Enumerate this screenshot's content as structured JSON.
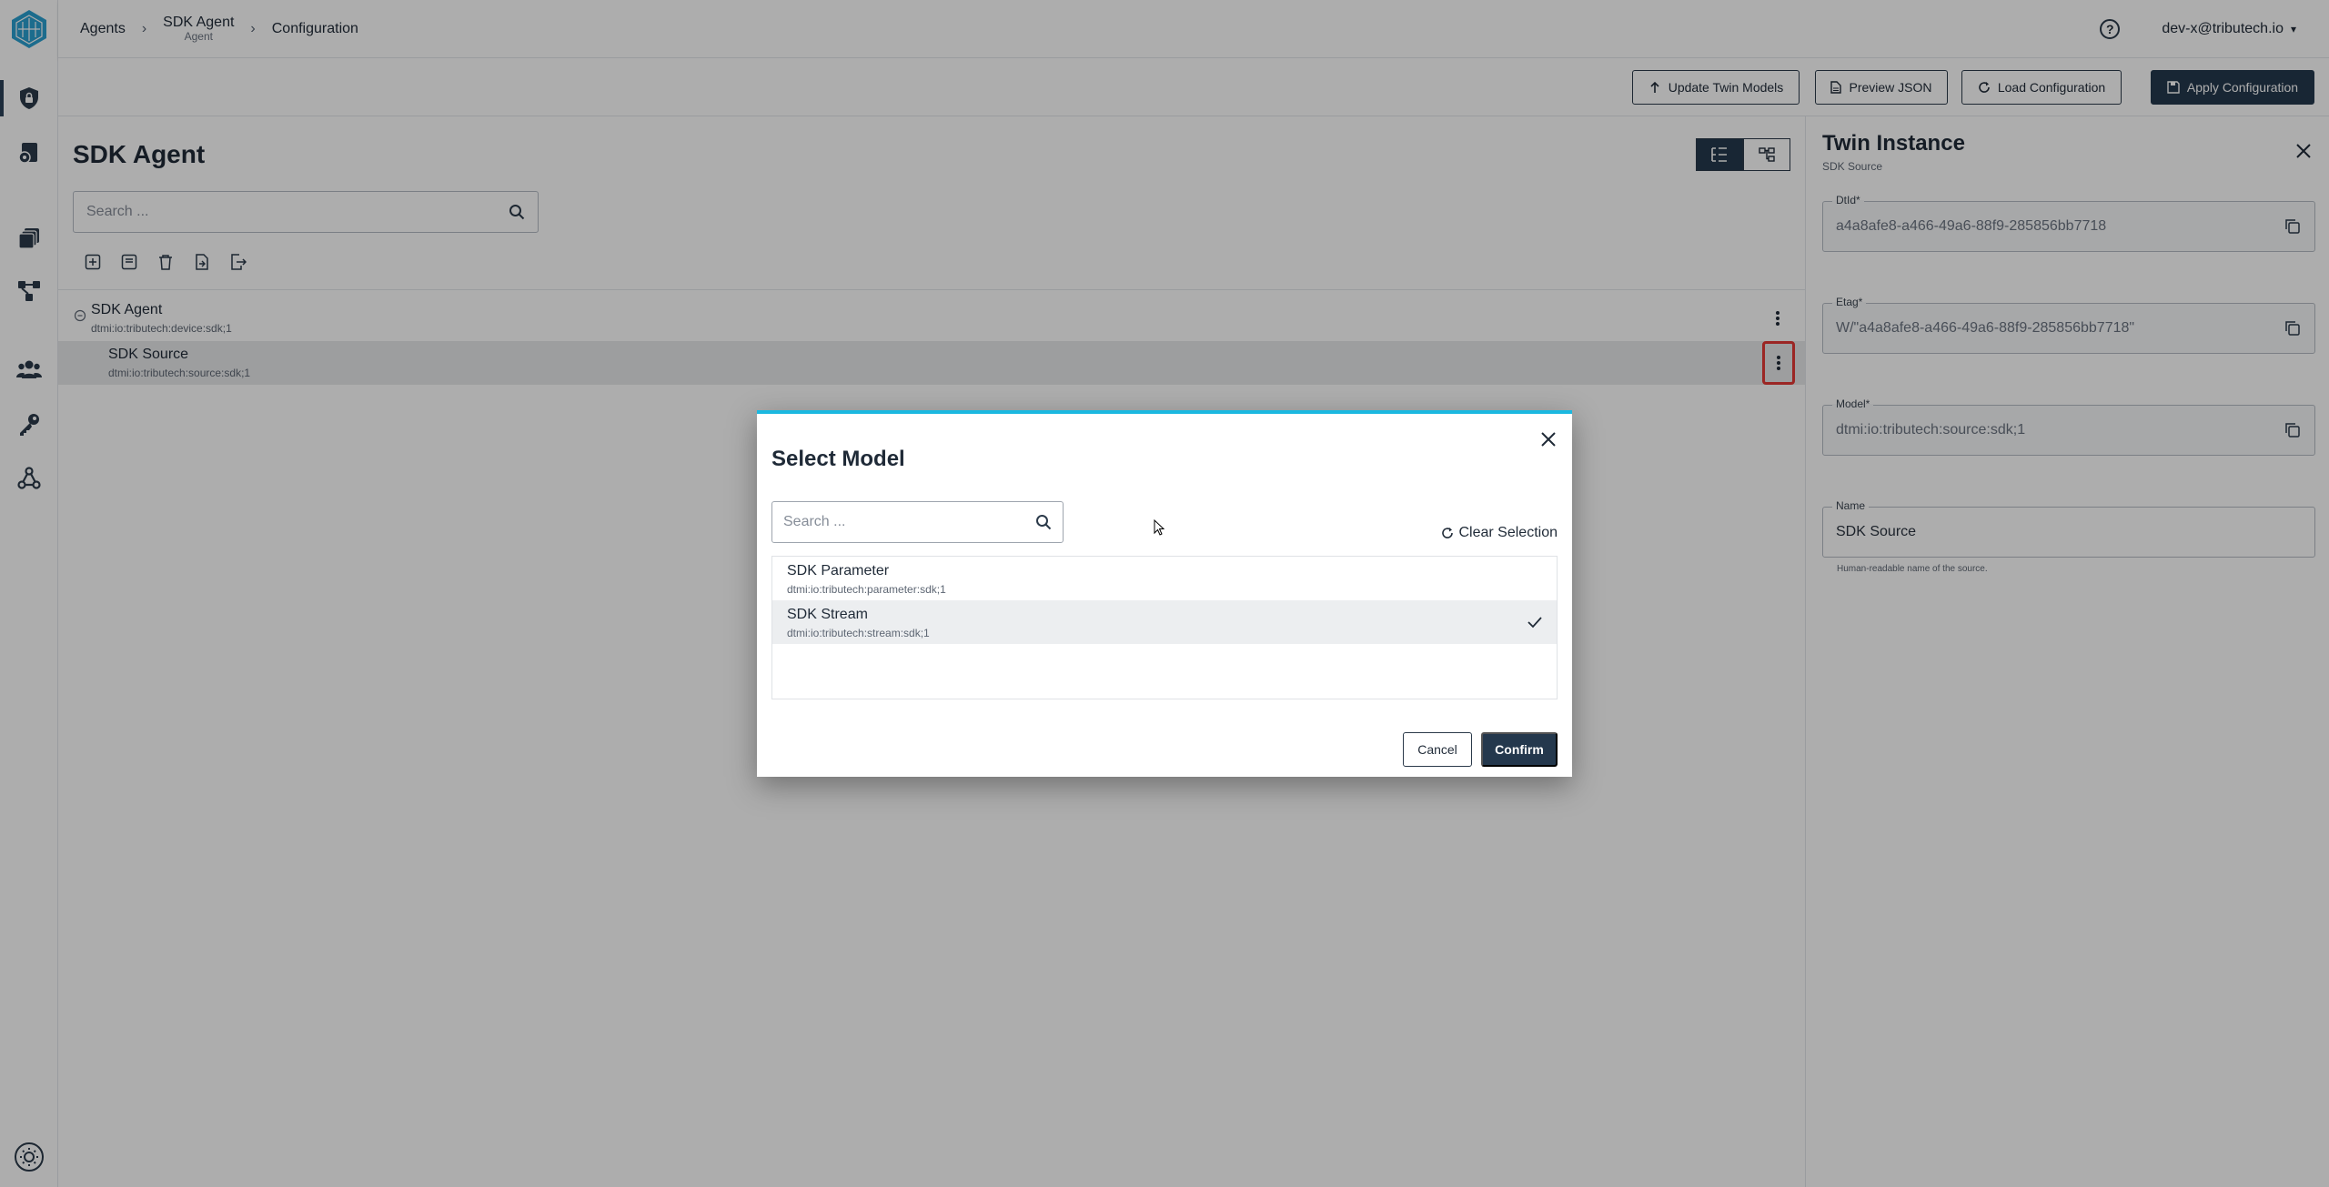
{
  "breadcrumb": {
    "items": [
      {
        "label": "Agents"
      },
      {
        "label": "SDK Agent",
        "sub": "Agent"
      },
      {
        "label": "Configuration"
      }
    ]
  },
  "header": {
    "user": "dev-x@tributech.io",
    "help_glyph": "?"
  },
  "actions": {
    "update_twin_models": "Update Twin Models",
    "preview_json": "Preview JSON",
    "load_configuration": "Load Configuration",
    "apply_configuration": "Apply Configuration"
  },
  "main": {
    "title": "SDK Agent",
    "search_placeholder": "Search ...",
    "tree": [
      {
        "name": "SDK Agent",
        "dtmi": "dtmi:io:tributech:device:sdk;1"
      },
      {
        "name": "SDK Source",
        "dtmi": "dtmi:io:tributech:source:sdk;1"
      }
    ]
  },
  "panel": {
    "title": "Twin Instance",
    "subtitle": "SDK Source",
    "fields": {
      "dtid": {
        "label": "DtId*",
        "value": "a4a8afe8-a466-49a6-88f9-285856bb7718"
      },
      "etag": {
        "label": "Etag*",
        "value": "W/\"a4a8afe8-a466-49a6-88f9-285856bb7718\""
      },
      "model": {
        "label": "Model*",
        "value": "dtmi:io:tributech:source:sdk;1"
      },
      "name": {
        "label": "Name",
        "value": "SDK Source",
        "hint": "Human-readable name of the source."
      }
    }
  },
  "dialog": {
    "title": "Select Model",
    "search_placeholder": "Search ...",
    "clear_selection": "Clear Selection",
    "items": [
      {
        "name": "SDK Parameter",
        "dtmi": "dtmi:io:tributech:parameter:sdk;1",
        "selected": false
      },
      {
        "name": "SDK Stream",
        "dtmi": "dtmi:io:tributech:stream:sdk;1",
        "selected": true
      }
    ],
    "cancel": "Cancel",
    "confirm": "Confirm"
  },
  "colors": {
    "primary": "#24384d",
    "accent": "#1bb8e0",
    "highlight": "#e53935",
    "logo": "#2a9fd0"
  },
  "icons": [
    "app-logo-icon",
    "shield-lock-icon",
    "settings-doc-icon",
    "stack-icon",
    "network-icon",
    "users-icon",
    "key-icon",
    "webhook-icon",
    "theme-icon",
    "help-icon",
    "upload-icon",
    "file-icon",
    "refresh-icon",
    "save-icon",
    "search-icon",
    "close-icon",
    "copy-icon",
    "check-icon",
    "kebab-icon"
  ]
}
